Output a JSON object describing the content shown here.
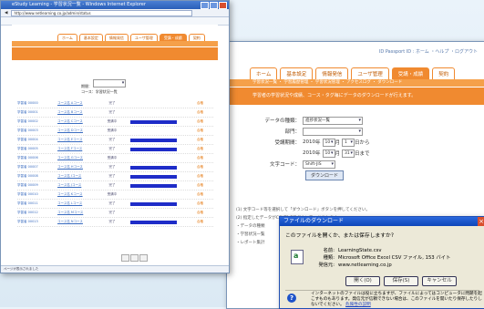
{
  "back_window": {
    "top_links": "ID Passport ID : ホーム ・ヘルプ ・ログアウト",
    "tabs": [
      "ホーム",
      "基本設定",
      "情報発信",
      "ユーザ管理",
      "受講・成績",
      "契約"
    ],
    "active_tab": 4,
    "subnav": "学習状況一覧 ・ 学習履歴管理 ・ 学習状況管理 ・ アクセスログ ・ ダウンロード",
    "banner_text": "学習者の学習状況や成績、コース・タグ毎にデータのダウンロードが行えます。",
    "form": {
      "data_type_label": "データの種類：",
      "data_type_value": "進捗状況一覧",
      "dept_label": "部門：",
      "dept_value": "",
      "period_label": "受講期間：",
      "period_from": [
        "2010",
        "年",
        "10",
        "月",
        "1",
        "日から"
      ],
      "period_to": [
        "2010",
        "年",
        "10",
        "月",
        "31",
        "日まで"
      ],
      "charset_label": "文字コード：",
      "charset_value": "Shift-JIS",
      "download_button": "ダウンロード"
    },
    "desc_lines": [
      "(1) 文字コード等を選択して「ダウンロード」ボタンを押してください。",
      "(2) 指定したデータがCSV形式でダウンロードされます。",
      "・データの種類",
      "・学習状況一覧",
      "・レポート集計"
    ]
  },
  "left_window": {
    "title": "eStudy Learning - 学習状況一覧 - Windows Internet Explorer",
    "address": "http://www.netlearning.co.jp/admin/status",
    "inner_tabs": [
      "ホーム",
      "基本設定",
      "情報発信",
      "ユーザ管理",
      "受講・成績",
      "契約"
    ],
    "filter_label": "期間：",
    "filter_note": "コース：学習状況一覧",
    "rows": [
      {
        "name": "学習者 00000",
        "course": "コース名 Aコース",
        "status": "完了",
        "progress": 0,
        "flag": "合格"
      },
      {
        "name": "学習者 00001",
        "course": "コース名 Bコース",
        "status": "完了",
        "progress": 0,
        "flag": "合格"
      },
      {
        "name": "学習者 00002",
        "course": "コース名 Cコース",
        "status": "受講中",
        "progress": 0.85,
        "flag": "合格"
      },
      {
        "name": "学習者 00003",
        "course": "コース名 Dコース",
        "status": "受講中",
        "progress": 0,
        "flag": "合格"
      },
      {
        "name": "学習者 00004",
        "course": "コース名 Eコース",
        "status": "完了",
        "progress": 0.85,
        "flag": "合格"
      },
      {
        "name": "学習者 00005",
        "course": "コース名 Fコース",
        "status": "完了",
        "progress": 0.85,
        "flag": "合格"
      },
      {
        "name": "学習者 00006",
        "course": "コース名 Gコース",
        "status": "受講中",
        "progress": 0,
        "flag": "合格"
      },
      {
        "name": "学習者 00007",
        "course": "コース名 Hコース",
        "status": "完了",
        "progress": 0.85,
        "flag": "合格"
      },
      {
        "name": "学習者 00008",
        "course": "コース名 Iコース",
        "status": "完了",
        "progress": 0.85,
        "flag": "合格"
      },
      {
        "name": "学習者 00009",
        "course": "コース名 Jコース",
        "status": "完了",
        "progress": 0.85,
        "flag": "合格"
      },
      {
        "name": "学習者 00010",
        "course": "コース名 Kコース",
        "status": "受講中",
        "progress": 0,
        "flag": "合格"
      },
      {
        "name": "学習者 00011",
        "course": "コース名 Lコース",
        "status": "完了",
        "progress": 0.85,
        "flag": "合格"
      },
      {
        "name": "学習者 00012",
        "course": "コース名 Mコース",
        "status": "完了",
        "progress": 0,
        "flag": "合格"
      },
      {
        "name": "学習者 00013",
        "course": "コース名 Nコース",
        "status": "完了",
        "progress": 0.85,
        "flag": "合格"
      }
    ],
    "status_text": "ページが表示されました"
  },
  "dialog": {
    "title": "ファイルのダウンロード",
    "question": "このファイルを開くか、または保存しますか?",
    "name_label": "名前:",
    "name_value": "LearningState.csv",
    "type_label": "種類:",
    "type_value": "Microsoft Office Excel CSV ファイル, 153 バイト",
    "from_label": "発信元:",
    "from_value": "www.netlearning.co.jp",
    "open_btn": "開く(O)",
    "save_btn": "保存(S)",
    "cancel_btn": "キャンセル",
    "warning": "インターネットのファイルは役に立ちますが、ファイルによってはコンピュータに問題を起こすものもあります。発信元が信頼できない場合は、このファイルを開いたり保存したりしないでください。",
    "warning_link": "危険性の説明"
  },
  "colors": {
    "accent": "#f08a30",
    "bar": "#1e2cc8",
    "title": "#2a5fb8"
  }
}
